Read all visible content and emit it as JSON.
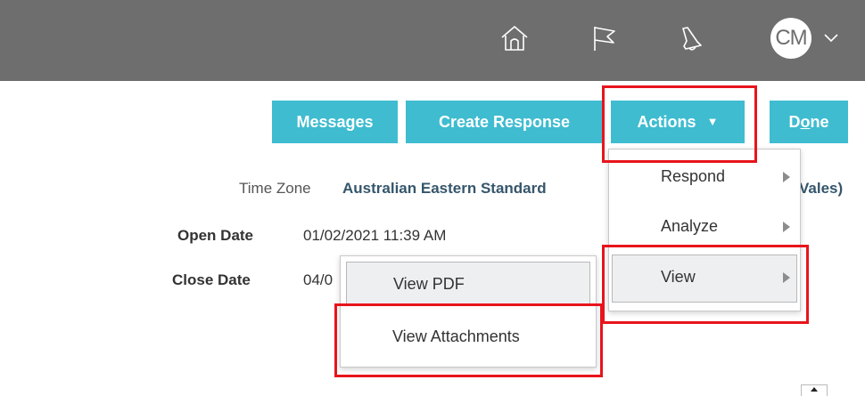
{
  "header": {
    "avatar_initials": "CM",
    "icons": [
      "home-icon",
      "flag-icon",
      "bell-icon",
      "chevron-down-icon"
    ],
    "background": "#6e6e6e"
  },
  "toolbar": {
    "messages_label": "Messages",
    "create_response_label": "Create Response",
    "actions_label": "Actions",
    "actions_caret": "▼",
    "done_label_prefix": "D",
    "done_label_underlined": "o",
    "done_label_suffix": "ne",
    "button_color": "#3fbcd0"
  },
  "details": {
    "time_zone_label": "Time Zone",
    "time_zone_value": "Australian Eastern Standard",
    "time_zone_value_tail": "Vales)",
    "open_date_label": "Open Date",
    "open_date_value": "01/02/2021 11:39 AM",
    "close_date_label": "Close Date",
    "close_date_value": "04/0"
  },
  "actions_menu": {
    "items": [
      {
        "label": "Respond",
        "has_submenu": true,
        "selected": false
      },
      {
        "label": "Analyze",
        "has_submenu": true,
        "selected": false
      },
      {
        "label": "View",
        "has_submenu": true,
        "selected": true
      }
    ]
  },
  "view_submenu": {
    "items": [
      {
        "label": "View PDF",
        "selected": true
      },
      {
        "label": "View Attachments",
        "selected": false
      }
    ]
  },
  "highlight_color": "#e8141c"
}
